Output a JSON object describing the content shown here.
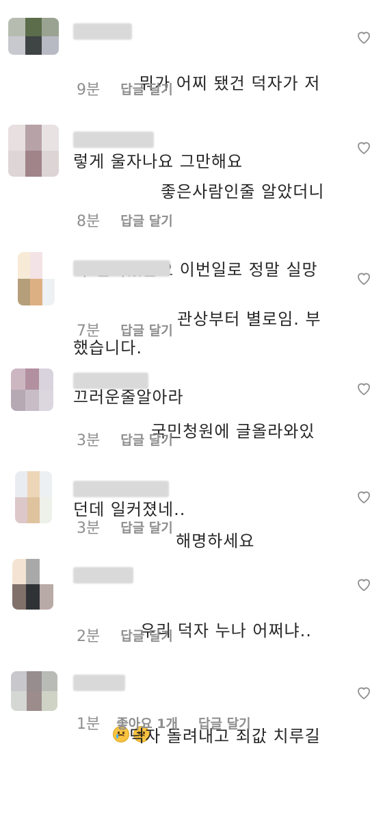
{
  "comments": [
    {
      "text": "뭐가 어찌 됐건 덕자가 저렇게 울자나요 그만해요",
      "line1": "뭐가 어찌 됐건 덕자가 저",
      "line2": "렇게 울자나요 그만해요",
      "time": "9분",
      "reply": "답글 달기",
      "avatar_colors": [
        "#b7bcb1",
        "#5b6d4a",
        "#9aa392",
        "#c8c9cf",
        "#3f4444",
        "#b8bac3"
      ]
    },
    {
      "text": "좋은사람인줄 알았더니 다 연기였군요 이번일로 정말 실망했습니다.",
      "line1": "좋은사람인줄 알았더니",
      "line2": "다 연기였군요 이번일로 정말 실망",
      "line3": "했습니다.",
      "time": "8분",
      "reply": "답글 달기",
      "avatar_colors": [
        "#e7dfe0",
        "#b7a2a8",
        "#e8e2e3",
        "#ddd5d6",
        "#a08489",
        "#ddd4d6"
      ]
    },
    {
      "text": "관상부터 별로임. 부끄러운줄알아라",
      "line1": "관상부터 별로임. 부",
      "line2": "끄러운줄알아라",
      "time": "7분",
      "reply": "답글 달기",
      "avatar_colors": [
        "#f7ead7",
        "#f4e3e6",
        "#ffffff",
        "#b59f7b",
        "#ddb084",
        "#eef1f3"
      ]
    },
    {
      "text": "국민청원에 글올라와있던데 일커졌네..",
      "line1": "국민청원에 글올라와있",
      "line2": "던데 일커졌네..",
      "time": "3분",
      "reply": "답글 달기",
      "avatar_colors": [
        "#ccb7c1",
        "#b3909f",
        "#d8d3dc",
        "#b7a9b4",
        "#c8bdc6",
        "#dcd7df"
      ]
    },
    {
      "text": "해명하세요",
      "line1": "해명하세요",
      "time": "3분",
      "reply": "답글 달기",
      "avatar_colors": [
        "#e9edf2",
        "#ecd6b7",
        "#ecf0f3",
        "#dcc7c9",
        "#dfc39f",
        "#eef0ea"
      ]
    },
    {
      "text": "우리 덕자 누나 어쩌냐..",
      "line1": "우리 덕자 누나 어쩌냐..",
      "time": "2분",
      "reply": "답글 달기",
      "avatar_colors": [
        "#f4e3d3",
        "#a8a9a8",
        "#ffffff",
        "#80716a",
        "#303336",
        "#b8aaa6"
      ]
    },
    {
      "text": "덕자 돌려내고 죄값 치루길",
      "line1": "덕자 돌려내고 죄값 치루길",
      "time": "1분",
      "likes": "좋아요 1개",
      "reply": "답글 달기",
      "avatar_colors": [
        "#c8c8cc",
        "#978d8f",
        "#b9bbb6",
        "#d5d7d4",
        "#9c8c8c",
        "#cfd3c6"
      ]
    }
  ]
}
